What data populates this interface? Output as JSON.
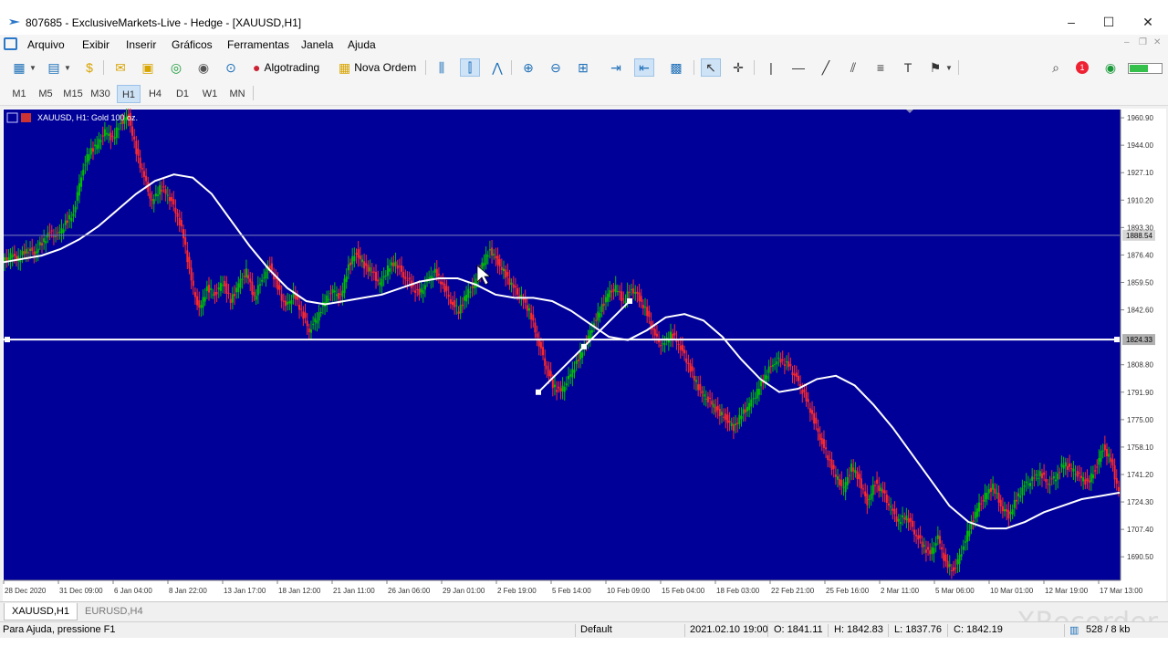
{
  "window": {
    "title": "807685 - ExclusiveMarkets-Live - Hedge - [XAUUSD,H1]",
    "controls": [
      "–",
      "☐",
      "✕"
    ]
  },
  "menu": {
    "items": [
      "Arquivo",
      "Exibir",
      "Inserir",
      "Gráficos",
      "Ferramentas",
      "Janela",
      "Ajuda"
    ]
  },
  "toolbar": {
    "algotrading_label": "Algotrading",
    "new_order_label": "Nova Ordem",
    "notification_count": "1"
  },
  "timeframes": {
    "items": [
      "M1",
      "M5",
      "M15",
      "M30",
      "H1",
      "H4",
      "D1",
      "W1",
      "MN"
    ],
    "active": "H1"
  },
  "chart": {
    "header": "XAUUSD, H1:  Gold 100 oz.",
    "colors": {
      "background": "#000099",
      "bull": "#00c000",
      "bear": "#ff2a2a",
      "moving_average": "#ffffff",
      "price_label_bg": "#b0b0b0"
    },
    "price_ticks": [
      "1960.90",
      "1944.00",
      "1927.10",
      "1910.20",
      "1893.30",
      "1876.40",
      "1859.50",
      "1842.60",
      "1824.33",
      "1808.80",
      "1791.90",
      "1775.00",
      "1758.10",
      "1741.20",
      "1724.30",
      "1707.40",
      "1690.50"
    ],
    "hline_labels": [
      "1888.54",
      "1824.33"
    ],
    "time_ticks": [
      "28 Dec 2020",
      "31 Dec 09:00",
      "6 Jan 04:00",
      "8 Jan 22:00",
      "13 Jan 17:00",
      "18 Jan 12:00",
      "21 Jan 11:00",
      "26 Jan 06:00",
      "29 Jan 01:00",
      "2 Feb 19:00",
      "5 Feb 14:00",
      "10 Feb 09:00",
      "15 Feb 04:00",
      "18 Feb 03:00",
      "22 Feb 21:00",
      "25 Feb 16:00",
      "2 Mar 11:00",
      "5 Mar 06:00",
      "10 Mar 01:00",
      "12 Mar 19:00",
      "17 Mar 13:00"
    ]
  },
  "chart_data": {
    "type": "line",
    "title": "XAUUSD, H1:  Gold 100 oz.",
    "xlabel": "",
    "ylabel": "",
    "ylim": [
      1676,
      1966
    ],
    "price_series_path": [
      1872,
      1876,
      1874,
      1880,
      1878,
      1884,
      1890,
      1888,
      1896,
      1902,
      1926,
      1940,
      1944,
      1952,
      1948,
      1958,
      1962,
      1940,
      1924,
      1908,
      1918,
      1914,
      1904,
      1888,
      1860,
      1842,
      1856,
      1852,
      1860,
      1848,
      1858,
      1866,
      1850,
      1862,
      1870,
      1856,
      1844,
      1852,
      1842,
      1830,
      1838,
      1848,
      1854,
      1850,
      1870,
      1878,
      1870,
      1866,
      1858,
      1868,
      1872,
      1864,
      1858,
      1852,
      1860,
      1866,
      1858,
      1848,
      1842,
      1852,
      1858,
      1870,
      1880,
      1872,
      1864,
      1856,
      1850,
      1842,
      1826,
      1810,
      1796,
      1792,
      1800,
      1810,
      1820,
      1832,
      1842,
      1852,
      1856,
      1848,
      1856,
      1850,
      1840,
      1826,
      1820,
      1828,
      1822,
      1812,
      1800,
      1790,
      1786,
      1780,
      1776,
      1770,
      1778,
      1784,
      1792,
      1802,
      1810,
      1812,
      1808,
      1800,
      1790,
      1778,
      1764,
      1752,
      1740,
      1732,
      1746,
      1738,
      1724,
      1736,
      1730,
      1720,
      1712,
      1716,
      1706,
      1698,
      1692,
      1702,
      1686,
      1682,
      1694,
      1708,
      1720,
      1728,
      1734,
      1722,
      1716,
      1726,
      1734,
      1738,
      1742,
      1736,
      1740,
      1748,
      1744,
      1740,
      1736,
      1744,
      1758,
      1750,
      1730
    ],
    "moving_average_path": [
      1872,
      1874,
      1876,
      1880,
      1886,
      1894,
      1904,
      1914,
      1922,
      1926,
      1924,
      1914,
      1898,
      1882,
      1868,
      1856,
      1848,
      1846,
      1848,
      1850,
      1852,
      1856,
      1860,
      1862,
      1862,
      1858,
      1852,
      1850,
      1850,
      1848,
      1842,
      1834,
      1826,
      1824,
      1830,
      1838,
      1840,
      1836,
      1826,
      1812,
      1800,
      1792,
      1794,
      1800,
      1802,
      1796,
      1784,
      1770,
      1754,
      1738,
      1722,
      1712,
      1708,
      1708,
      1712,
      1718,
      1722,
      1726,
      1728,
      1730
    ],
    "horizontal_lines": [
      1888.54,
      1824.33
    ],
    "trendline": [
      [
        1791.9,
        1848.0
      ]
    ]
  },
  "tabs": {
    "items": [
      "XAUUSD,H1",
      "EURUSD,H4"
    ],
    "active": "XAUUSD,H1"
  },
  "status": {
    "help": "Para Ajuda, pressione F1",
    "profile": "Default",
    "datetime": "2021.02.10 19:00",
    "open": "O: 1841.11",
    "high": "H: 1842.83",
    "low": "L: 1837.76",
    "close": "C: 1842.19",
    "traffic": "528 / 8 kb"
  },
  "watermark": "XRecorder"
}
